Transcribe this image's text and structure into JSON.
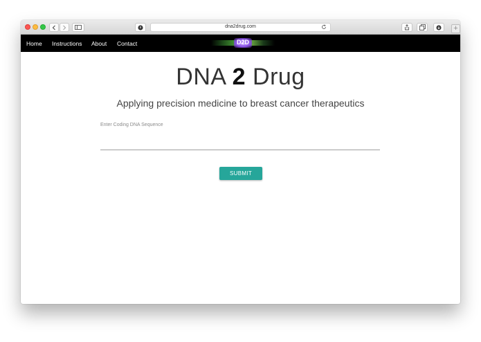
{
  "browser": {
    "url": "dna2drug.com",
    "new_tab_label": "+"
  },
  "nav": {
    "links": [
      "Home",
      "Instructions",
      "About",
      "Contact"
    ],
    "logo_text": "D2D"
  },
  "main": {
    "title_prefix": "DNA",
    "title_number": "2",
    "title_suffix": "Drug",
    "subtitle": "Applying precision medicine to breast cancer therapeutics",
    "input_label": "Enter Coding DNA Sequence",
    "input_value": "",
    "submit_label": "SUBMIT"
  },
  "colors": {
    "navbar": "#000000",
    "submit_button": "#26a69a",
    "logo_accent": "#8a52e6"
  }
}
